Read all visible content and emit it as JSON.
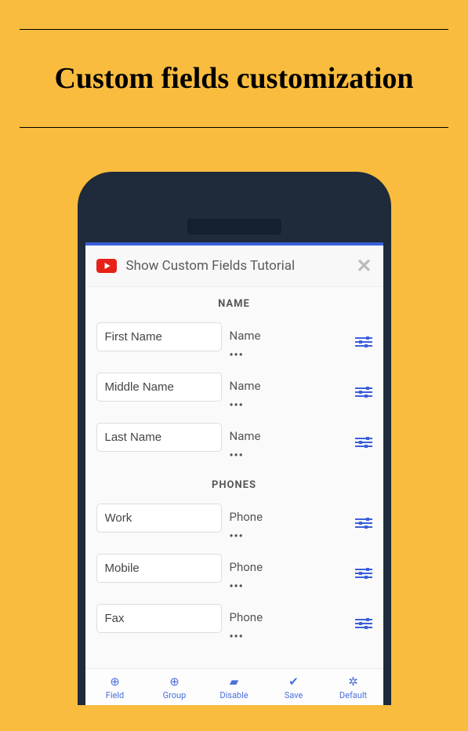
{
  "page": {
    "title": "Custom fields customization"
  },
  "app": {
    "header_title": "Show Custom Fields Tutorial"
  },
  "sections": {
    "name": {
      "header": "NAME",
      "fields": [
        {
          "label": "First Name",
          "type": "Name"
        },
        {
          "label": "Middle Name",
          "type": "Name"
        },
        {
          "label": "Last Name",
          "type": "Name"
        }
      ]
    },
    "phones": {
      "header": "PHONES",
      "fields": [
        {
          "label": "Work",
          "type": "Phone"
        },
        {
          "label": "Mobile",
          "type": "Phone"
        },
        {
          "label": "Fax",
          "type": "Phone"
        }
      ]
    }
  },
  "dots": "•••",
  "bottom_bar": [
    {
      "icon": "plus-circle",
      "label": "Field"
    },
    {
      "icon": "plus-circle",
      "label": "Group"
    },
    {
      "icon": "eraser",
      "label": "Disable"
    },
    {
      "icon": "check",
      "label": "Save"
    },
    {
      "icon": "gears",
      "label": "Default"
    }
  ]
}
